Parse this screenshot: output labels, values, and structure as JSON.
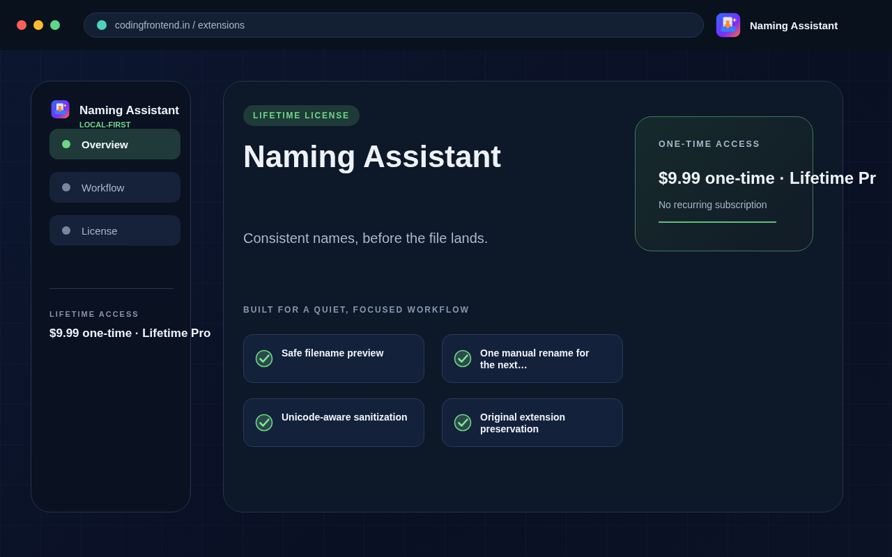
{
  "browser": {
    "url": "codingfrontend.in / extensions",
    "app_name": "Naming Assistant"
  },
  "sidebar": {
    "app_name": "Naming Assistant",
    "tagline": "LOCAL-FIRST",
    "items": [
      {
        "label": "Overview",
        "selected": true
      },
      {
        "label": "Workflow",
        "selected": false
      },
      {
        "label": "License",
        "selected": false
      }
    ],
    "access_label": "LIFETIME ACCESS",
    "access_price": "$9.99 one-time · Lifetime Pro"
  },
  "main": {
    "badge": "LIFETIME LICENSE",
    "title": "Naming Assistant",
    "subtitle": "Consistent names, before the file lands.",
    "features_heading": "BUILT FOR A QUIET, FOCUSED WORKFLOW",
    "features": [
      {
        "text": "Safe filename preview"
      },
      {
        "text": "One manual rename for the next…"
      },
      {
        "text": "Unicode-aware sanitization"
      },
      {
        "text": "Original extension preservation"
      }
    ]
  },
  "price_card": {
    "label": "ONE-TIME ACCESS",
    "price": "$9.99 one-time · Lifetime Pr",
    "note": "No recurring subscription"
  }
}
